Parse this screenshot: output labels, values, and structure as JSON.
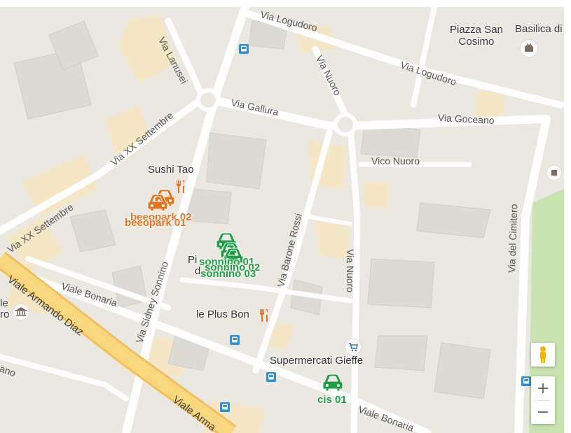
{
  "streets": {
    "via_logudoro_top": "Via Logudoro",
    "via_logudoro_right": "Via Logudoro",
    "via_lanusei": "Via Lanusei",
    "via_nuoro_top": "Via Nuoro",
    "via_gallura": "Via Gallura",
    "via_goceano": "Via Goceano",
    "via_xx_settembre_1": "Via XX Settembre",
    "via_xx_settembre_2": "Via XX Settembre",
    "vico_nuoro": "Vico Nuoro",
    "via_barone_rossi": "Via Barone Rossi",
    "via_nuoro_mid": "Via Nuoro",
    "via_del_cimitero": "Via del Cimitero",
    "viale_bonaria_left": "Viale Bonaria",
    "viale_armando_diaz": "Viale Armando Diaz",
    "via_sidney_sonnino": "Via Sidney Sonnino",
    "viale_bonaria_bottom": "Viale Bonaria",
    "viale_arma": "Viale Arma",
    "ano": "ano"
  },
  "places": {
    "piazza_san_cosimo": "Piazza San\nCosimo",
    "basilica": "Basilica di",
    "sushi_tao": "Sushi Tao",
    "le_plus_bon": "le Plus Bon",
    "supermercati": "Supermercati Gieffe",
    "pi_label": "Pi",
    "d_label": "d",
    "museum_left_1": "le",
    "museum_left_2": "ro"
  },
  "markers": {
    "beeopark_02": "beeopark 02",
    "beeopark_01": "beeopark 01",
    "sonnino_01": "sonnino 01",
    "sonnino_02": "sonnino 02",
    "sonnino_03": "sonnino 03",
    "cis_01": "cis 01"
  },
  "controls": {
    "zoom_in": "+",
    "zoom_out": "−"
  },
  "colors": {
    "marker_orange": "#e8711c",
    "marker_green": "#1e9e43",
    "road_major": "#f7c95a",
    "park": "#c8e3b0",
    "bus_blue": "#2f8ed8"
  }
}
